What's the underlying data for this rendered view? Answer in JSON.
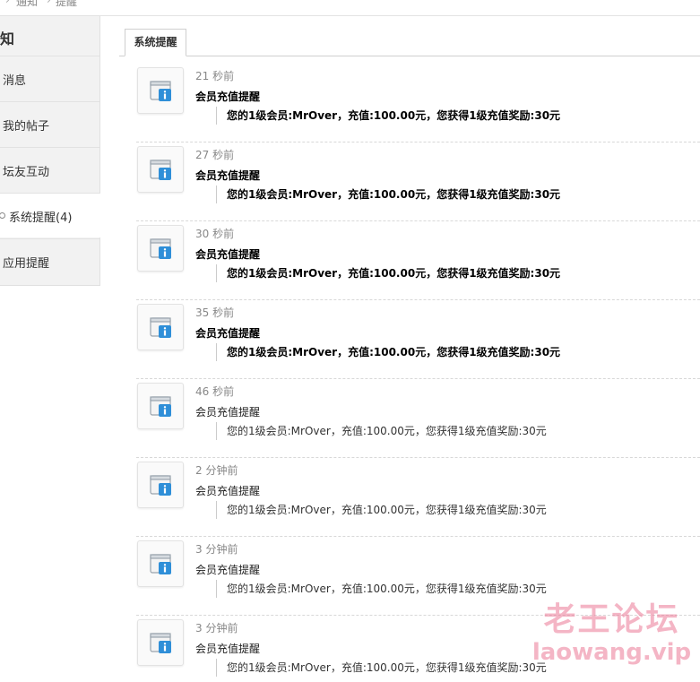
{
  "breadcrumb": {
    "items": [
      "通知",
      "提醒"
    ],
    "separator": "›"
  },
  "sidebar": {
    "title": "知",
    "items": [
      {
        "label": "消息"
      },
      {
        "label": "我的帖子"
      },
      {
        "label": "坛友互动"
      },
      {
        "label": "系统提醒(4)"
      },
      {
        "label": "应用提醒"
      }
    ],
    "active_index": 3
  },
  "tabs": [
    {
      "label": "系统提醒"
    }
  ],
  "notices": [
    {
      "time": "21 秒前",
      "title": "会员充值提醒",
      "body": "您的1级会员:MrOver，充值:100.00元，您获得1级充值奖励:30元",
      "unread": true,
      "icon": "info-window-icon"
    },
    {
      "time": "27 秒前",
      "title": "会员充值提醒",
      "body": "您的1级会员:MrOver，充值:100.00元，您获得1级充值奖励:30元",
      "unread": true,
      "icon": "info-window-icon"
    },
    {
      "time": "30 秒前",
      "title": "会员充值提醒",
      "body": "您的1级会员:MrOver，充值:100.00元，您获得1级充值奖励:30元",
      "unread": true,
      "icon": "info-window-icon"
    },
    {
      "time": "35 秒前",
      "title": "会员充值提醒",
      "body": "您的1级会员:MrOver，充值:100.00元，您获得1级充值奖励:30元",
      "unread": true,
      "icon": "info-window-icon"
    },
    {
      "time": "46 秒前",
      "title": "会员充值提醒",
      "body": "您的1级会员:MrOver，充值:100.00元，您获得1级充值奖励:30元",
      "unread": false,
      "icon": "info-window-icon"
    },
    {
      "time": "2 分钟前",
      "title": "会员充值提醒",
      "body": "您的1级会员:MrOver，充值:100.00元，您获得1级充值奖励:30元",
      "unread": false,
      "icon": "info-window-icon"
    },
    {
      "time": "3 分钟前",
      "title": "会员充值提醒",
      "body": "您的1级会员:MrOver，充值:100.00元，您获得1级充值奖励:30元",
      "unread": false,
      "icon": "info-window-icon"
    },
    {
      "time": "3 分钟前",
      "title": "会员充值提醒",
      "body": "您的1级会员:MrOver，充值:100.00元，您获得1级充值奖励:30元",
      "unread": false,
      "icon": "info-window-icon"
    }
  ],
  "watermark": {
    "line1": "老王论坛",
    "line2": "laowang.vip"
  },
  "colors": {
    "accent_blue": "#2f8fd8",
    "watermark": "#eb7896",
    "sidebar_bg": "#f2f2f2"
  }
}
